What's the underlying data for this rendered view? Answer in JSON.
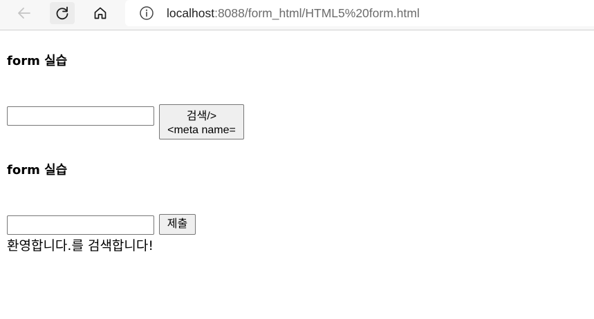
{
  "browser": {
    "url_host": "localhost",
    "url_path": ":8088/form_html/HTML5%20form.html",
    "icons": [
      "back-arrow-icon",
      "reload-icon",
      "home-icon",
      "info-icon"
    ]
  },
  "forms": [
    {
      "heading": "form 실습",
      "input_value": "",
      "button_line1": "검색/>",
      "button_line2": "<meta name="
    },
    {
      "heading": "form 실습",
      "input_value": "",
      "button_label": "제출"
    }
  ],
  "result_text": "환영합니다.를 검색합니다!"
}
